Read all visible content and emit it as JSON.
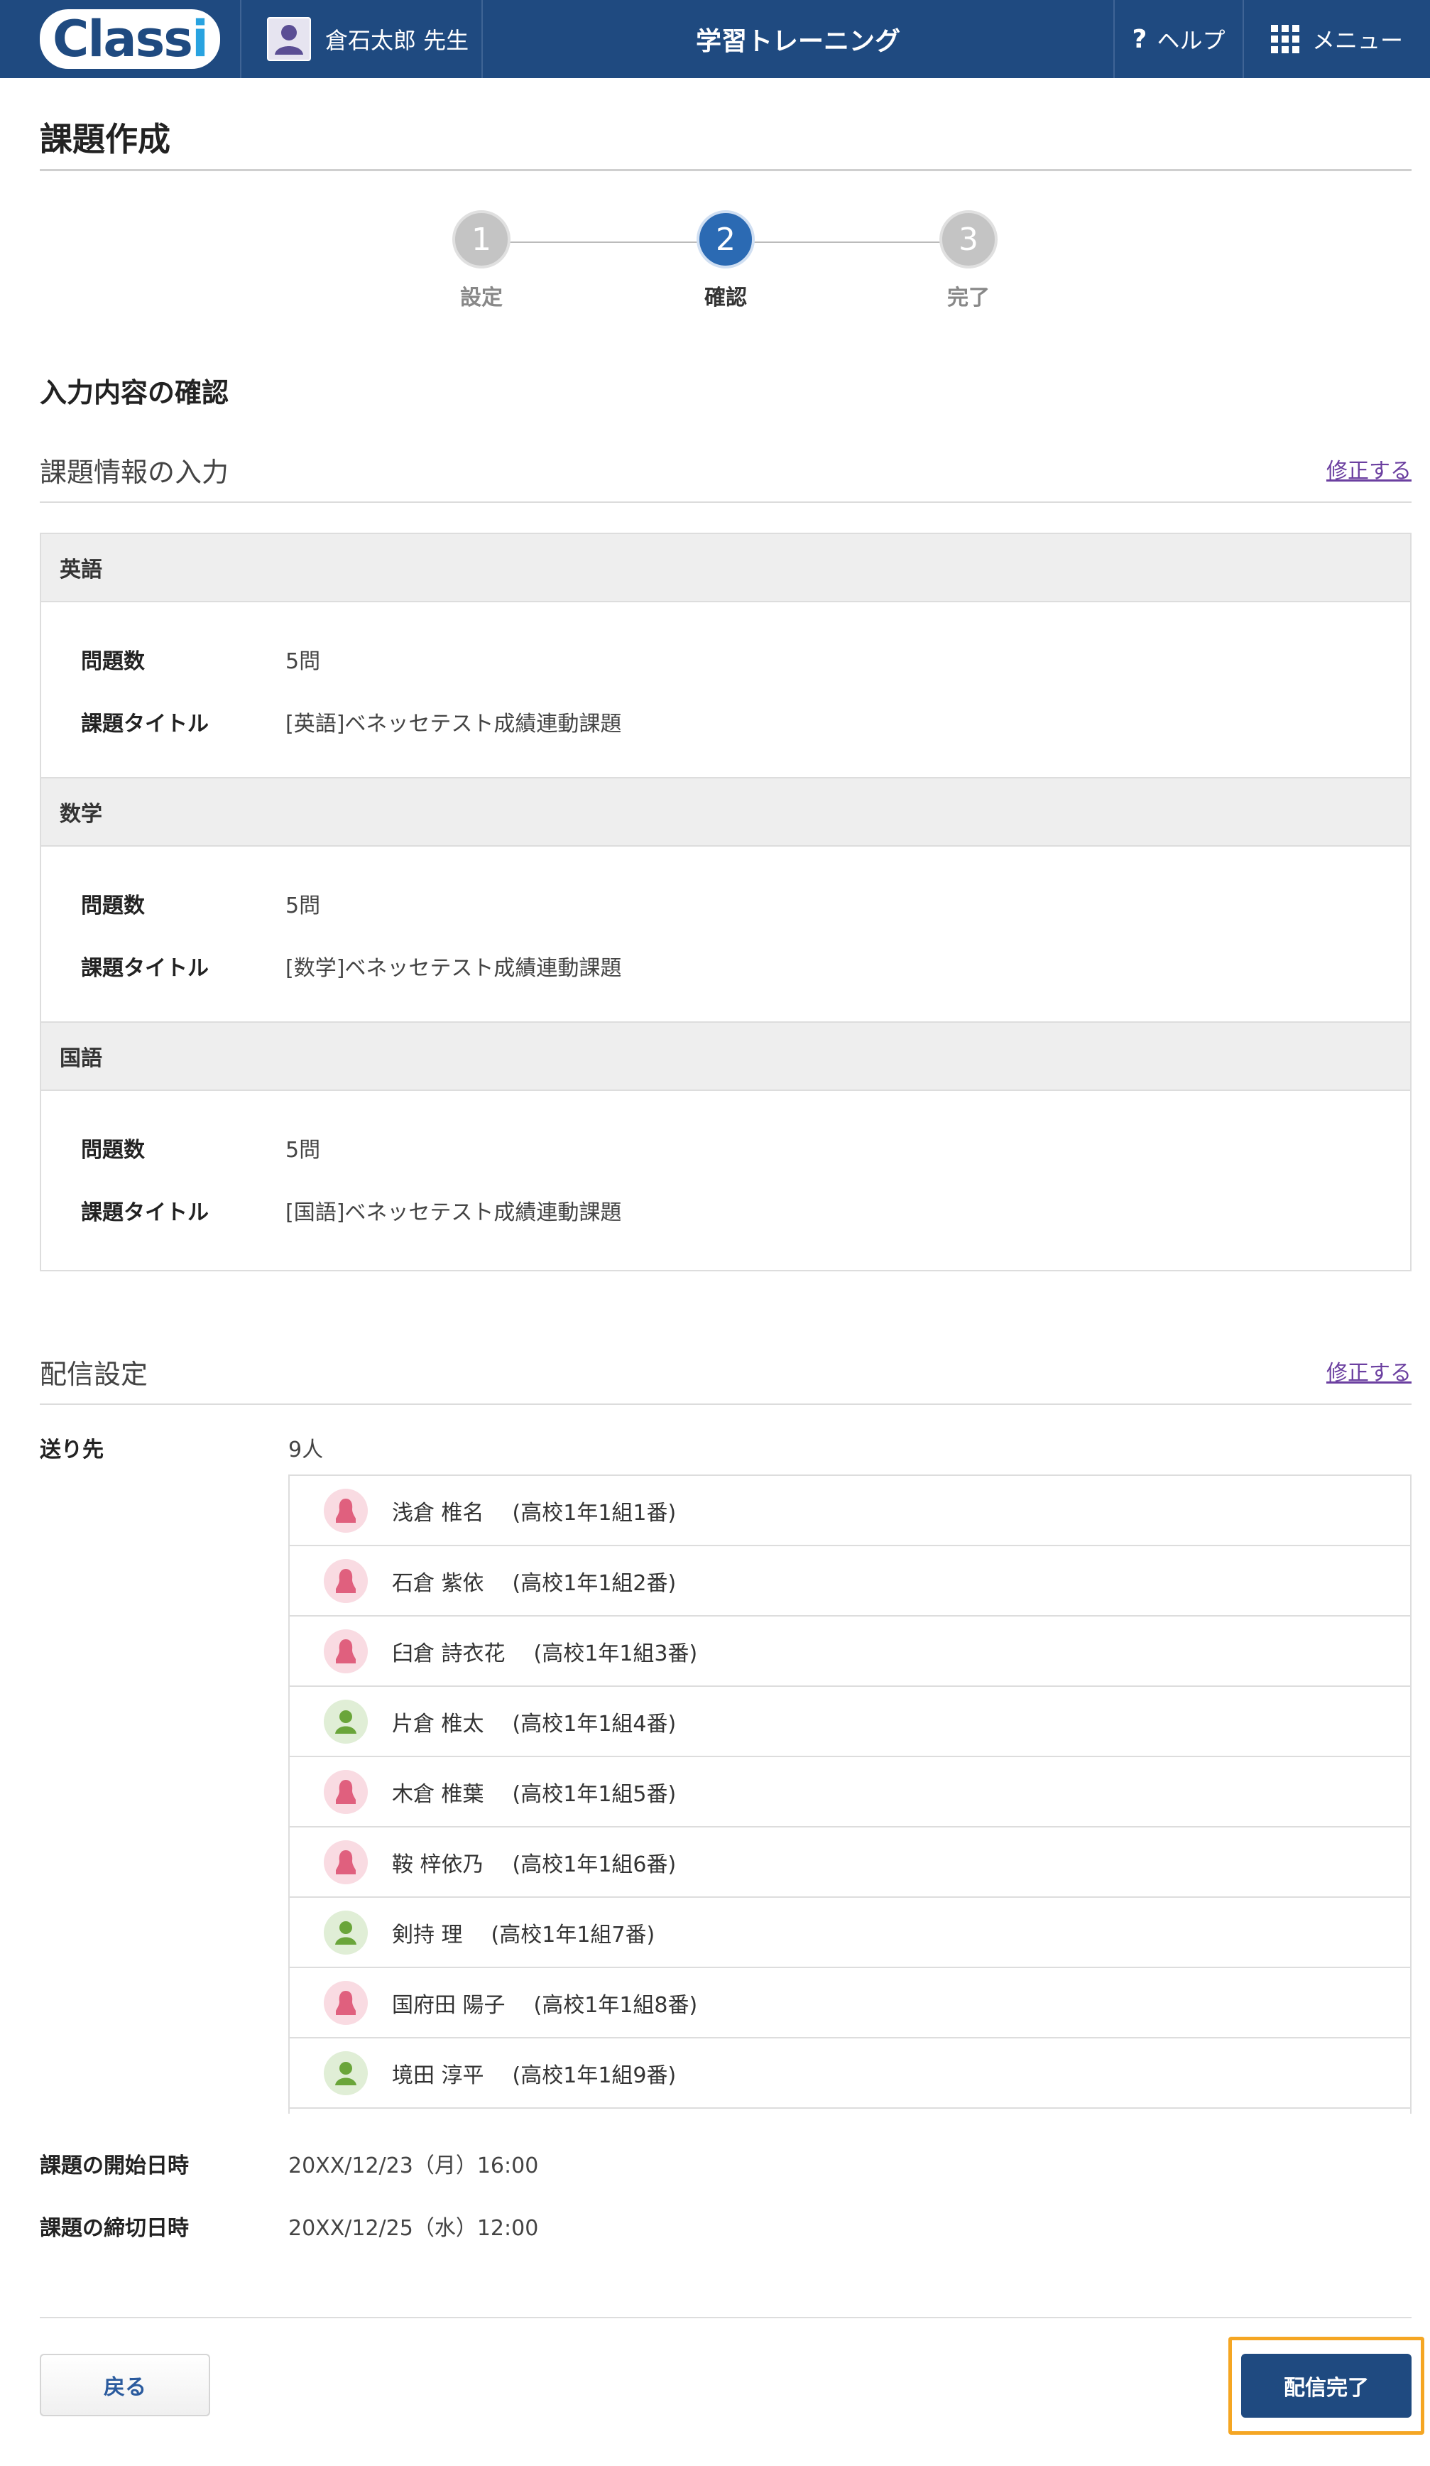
{
  "header": {
    "logo_text_main": "Class",
    "logo_text_accent": "i",
    "user_name": "倉石太郎 先生",
    "app_title": "学習トレーニング",
    "help_label": "ヘルプ",
    "menu_label": "メニュー",
    "colors": {
      "bar": "#1f4a80",
      "logo_accent": "#29a3e0"
    }
  },
  "page": {
    "title": "課題作成"
  },
  "steps": [
    {
      "number": "1",
      "label": "設定",
      "active": false
    },
    {
      "number": "2",
      "label": "確認",
      "active": true
    },
    {
      "number": "3",
      "label": "完了",
      "active": false
    }
  ],
  "confirm_heading": "入力内容の確認",
  "assignment_info": {
    "title": "課題情報の入力",
    "edit_label": "修正する",
    "field_labels": {
      "count": "問題数",
      "title": "課題タイトル"
    },
    "subjects": [
      {
        "name": "英語",
        "count": "5問",
        "assignment_title": "[英語]ベネッセテスト成績連動課題"
      },
      {
        "name": "数学",
        "count": "5問",
        "assignment_title": "[数学]ベネッセテスト成績連動課題"
      },
      {
        "name": "国語",
        "count": "5問",
        "assignment_title": "[国語]ベネッセテスト成績連動課題"
      }
    ]
  },
  "distribution": {
    "title": "配信設定",
    "edit_label": "修正する",
    "recipients_label": "送り先",
    "recipients_count": "9人",
    "recipients": [
      {
        "name": "浅倉 椎名",
        "grade": "(高校1年1組1番)",
        "gender": "female"
      },
      {
        "name": "石倉 紫依",
        "grade": "(高校1年1組2番)",
        "gender": "female"
      },
      {
        "name": "臼倉 詩衣花",
        "grade": "(高校1年1組3番)",
        "gender": "female"
      },
      {
        "name": "片倉 椎太",
        "grade": "(高校1年1組4番)",
        "gender": "male"
      },
      {
        "name": "木倉 椎葉",
        "grade": "(高校1年1組5番)",
        "gender": "female"
      },
      {
        "name": "鞍 梓依乃",
        "grade": "(高校1年1組6番)",
        "gender": "female"
      },
      {
        "name": "剣持 理",
        "grade": "(高校1年1組7番)",
        "gender": "male"
      },
      {
        "name": "国府田 陽子",
        "grade": "(高校1年1組8番)",
        "gender": "female"
      },
      {
        "name": "境田 淳平",
        "grade": "(高校1年1組9番)",
        "gender": "male"
      }
    ],
    "start_label": "課題の開始日時",
    "start_value": "20XX/12/23（月）16:00",
    "end_label": "課題の締切日時",
    "end_value": "20XX/12/25（水）12:00"
  },
  "actions": {
    "back_label": "戻る",
    "submit_label": "配信完了"
  }
}
